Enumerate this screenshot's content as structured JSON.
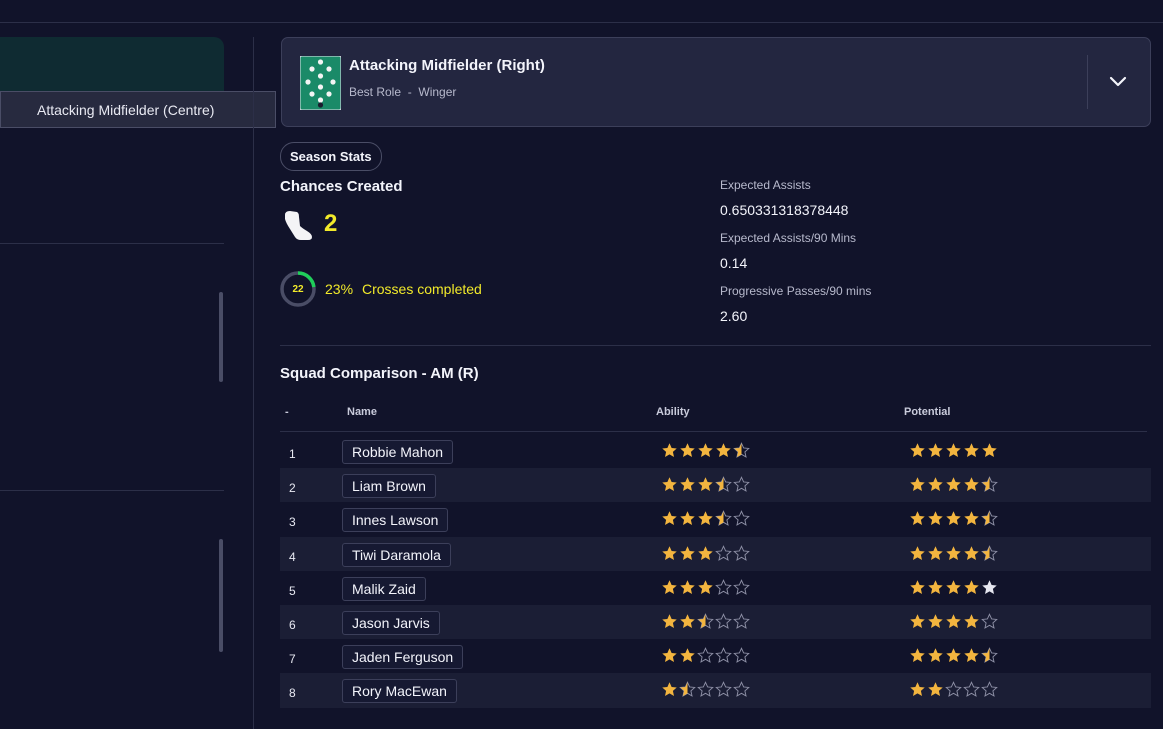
{
  "left": {
    "tooltip": "Attacking Midfielder (Centre)"
  },
  "role": {
    "title": "Attacking Midfielder (Right)",
    "best_role_label": "Best Role",
    "separator": "-",
    "best_role_value": "Winger"
  },
  "season": {
    "chip": "Season Stats",
    "chances_title": "Chances Created",
    "chances_value": "2",
    "ring_value": "22",
    "ring_fraction": 0.23,
    "crosses_pct": "23%",
    "crosses_label": "Crosses completed",
    "stats": [
      {
        "label": "Expected Assists",
        "value": "0.650331318378448"
      },
      {
        "label": "Expected Assists/90 Mins",
        "value": "0.14"
      },
      {
        "label": "Progressive Passes/90 mins",
        "value": "2.60"
      }
    ]
  },
  "squad": {
    "title": "Squad Comparison - AM (R)",
    "headers": {
      "rank": "-",
      "name": "Name",
      "ability": "Ability",
      "potential": "Potential"
    },
    "rows": [
      {
        "rank": "1",
        "name": "Robbie Mahon",
        "ability": 4.5,
        "potential": 5
      },
      {
        "rank": "2",
        "name": "Liam Brown",
        "ability": 3.5,
        "potential": 4.5
      },
      {
        "rank": "3",
        "name": "Innes Lawson",
        "ability": 3.5,
        "potential": 4.5
      },
      {
        "rank": "4",
        "name": "Tiwi Daramola",
        "ability": 3,
        "potential": 4.5
      },
      {
        "rank": "5",
        "name": "Malik Zaid",
        "ability": 3,
        "potential": 4,
        "potential_extra_white": 1
      },
      {
        "rank": "6",
        "name": "Jason Jarvis",
        "ability": 2.5,
        "potential": 4
      },
      {
        "rank": "7",
        "name": "Jaden Ferguson",
        "ability": 2,
        "potential": 4.5
      },
      {
        "rank": "8",
        "name": "Rory MacEwan",
        "ability": 1.5,
        "potential": 2
      }
    ]
  },
  "colors": {
    "star_gold": "#f3b53f",
    "star_empty": "#8e90a6",
    "star_white": "#e6e7f0",
    "accent_yellow": "#f2ea2a",
    "ring_green": "#1fcf5a",
    "pitch_green": "#1a8a68"
  },
  "icons": {
    "role": "pitch-formation-icon",
    "dropdown": "chevron-down-icon",
    "chances": "boot-icon",
    "progress": "progress-ring-icon",
    "star": "star-icon"
  }
}
